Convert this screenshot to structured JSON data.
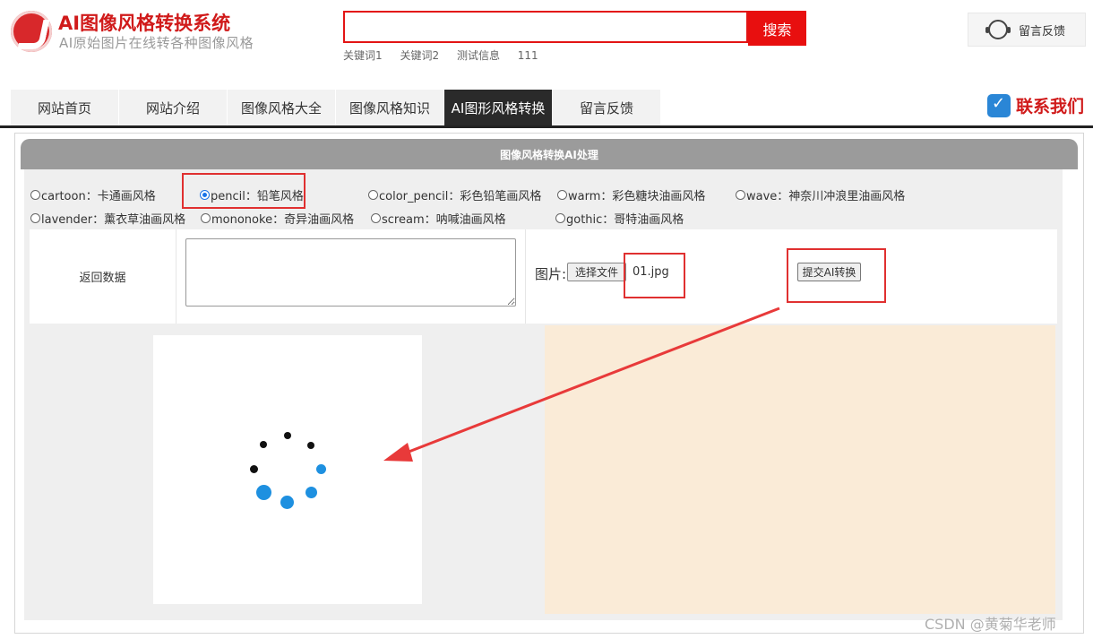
{
  "header": {
    "site_title": "AI图像风格转换系统",
    "site_subtitle": "AI原始图片在线转各种图像风格",
    "search": {
      "value": "",
      "button_label": "搜索"
    },
    "hot_keywords": [
      "关键词1",
      "关键词2",
      "测试信息",
      "111"
    ],
    "feedback_label": "留言反馈"
  },
  "nav": {
    "items": [
      {
        "label": "网站首页"
      },
      {
        "label": "网站介绍"
      },
      {
        "label": "图像风格大全"
      },
      {
        "label": "图像风格知识"
      },
      {
        "label": "AI图形风格转换",
        "active": true
      },
      {
        "label": "留言反馈"
      }
    ],
    "contact_label": "联系我们"
  },
  "panel": {
    "title": "图像风格转换AI处理",
    "styles": [
      {
        "label": "cartoon：卡通画风格",
        "checked": false
      },
      {
        "label": "pencil：铅笔风格",
        "checked": true
      },
      {
        "label": "color_pencil：彩色铅笔画风格",
        "checked": false
      },
      {
        "label": "warm：彩色糖块油画风格",
        "checked": false
      },
      {
        "label": "wave：神奈川冲浪里油画风格",
        "checked": false
      },
      {
        "label": "lavender：薰衣草油画风格",
        "checked": false
      },
      {
        "label": "mononoke：奇异油画风格",
        "checked": false
      },
      {
        "label": "scream：呐喊油画风格",
        "checked": false
      },
      {
        "label": "gothic：哥特油画风格",
        "checked": false
      }
    ],
    "return_label": "返回数据",
    "result_value": "",
    "image_label": "图片:",
    "file_button_label": "选择文件",
    "file_name": "01.jpg",
    "submit_label": "提交AI转换"
  },
  "colors": {
    "brand_red": "#d01a1a",
    "search_red": "#e80f0f",
    "annotation_red": "#e03030",
    "spinner_blue": "#1e90e0",
    "result_bg": "#faebd7"
  },
  "watermark": "CSDN @黄菊华老师"
}
